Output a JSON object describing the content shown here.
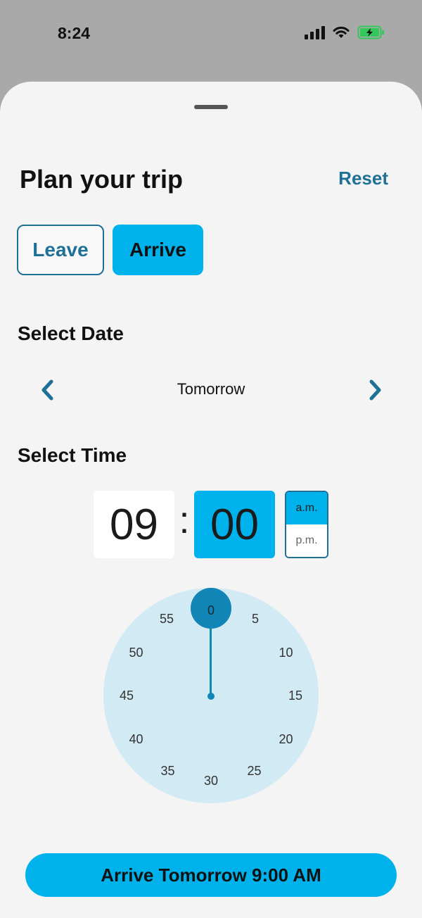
{
  "status": {
    "time": "8:24"
  },
  "header": {
    "title": "Plan your trip",
    "reset_label": "Reset"
  },
  "mode": {
    "leave_label": "Leave",
    "arrive_label": "Arrive",
    "selected": "Arrive"
  },
  "date": {
    "section_label": "Select Date",
    "value": "Tomorrow"
  },
  "time": {
    "section_label": "Select Time",
    "hour": "09",
    "separator": ":",
    "minute": "00",
    "am_label": "a.m.",
    "pm_label": "p.m.",
    "selected_period": "a.m."
  },
  "clock": {
    "selected_minute": "0",
    "labels": [
      "0",
      "5",
      "10",
      "15",
      "20",
      "25",
      "30",
      "35",
      "40",
      "45",
      "50",
      "55"
    ]
  },
  "cta": {
    "label": "Arrive Tomorrow 9:00 AM"
  },
  "colors": {
    "accent": "#00b2ec",
    "brand": "#1e7096",
    "clock_face": "#d2eaf4",
    "clock_hand": "#1185b6"
  }
}
